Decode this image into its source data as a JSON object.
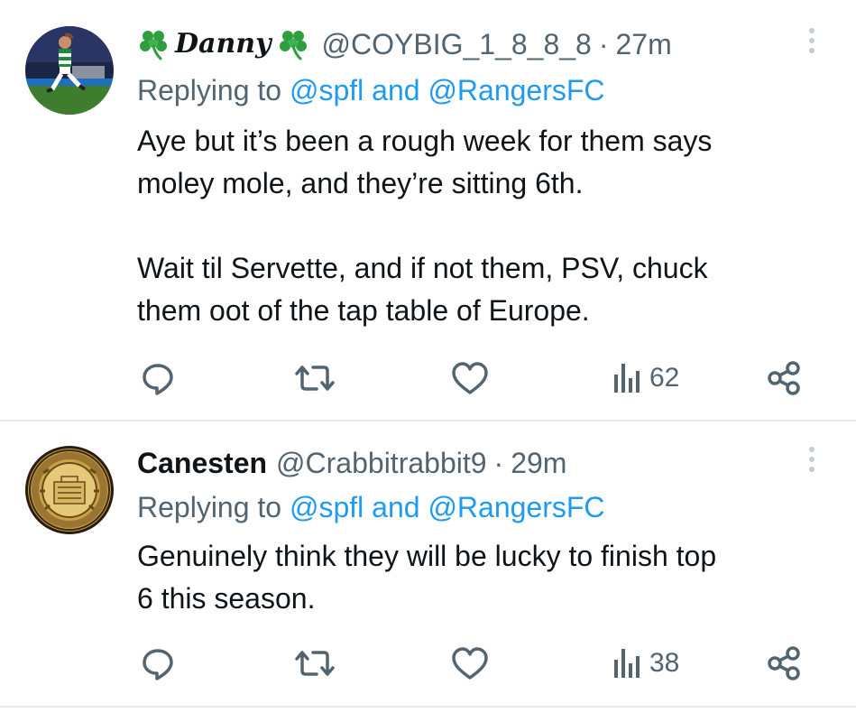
{
  "tweets": [
    {
      "display_name": "Danny",
      "name_emoji": "🍀",
      "handle": "@COYBIG_1_8_8_8",
      "separator": "·",
      "time": "27m",
      "replying_prefix": "Replying to",
      "replying_to_1": "@spfl",
      "replying_and": "and",
      "replying_to_2": "@RangersFC",
      "text_lines": [
        "Aye but it’s been a rough week for them says",
        "moley mole, and they’re sitting 6th.",
        "",
        "Wait til Servette, and if not them, PSV, chuck",
        "them oot of the tap table of Europe."
      ],
      "views": "62",
      "avatar_icon": "footballer-photo-avatar",
      "icons": [
        "reply-icon",
        "retweet-icon",
        "like-icon",
        "views-icon",
        "share-icon",
        "more-options-icon"
      ]
    },
    {
      "display_name": "Canesten",
      "handle": "@Crabbitrabbit9",
      "separator": "·",
      "time": "29m",
      "replying_prefix": "Replying to",
      "replying_to_1": "@spfl",
      "replying_and": "and",
      "replying_to_2": "@RangersFC",
      "text_lines": [
        "Genuinely think they will be lucky to finish top",
        "6 this season."
      ],
      "views": "38",
      "avatar_icon": "gold-crest-avatar",
      "icons": [
        "reply-icon",
        "retweet-icon",
        "like-icon",
        "views-icon",
        "share-icon",
        "more-options-icon"
      ]
    }
  ],
  "colors": {
    "text": "#0f1419",
    "secondary": "#536471",
    "link": "#1d9bf0",
    "divider": "#e7e9ea",
    "clover": "#2e9e3e"
  }
}
